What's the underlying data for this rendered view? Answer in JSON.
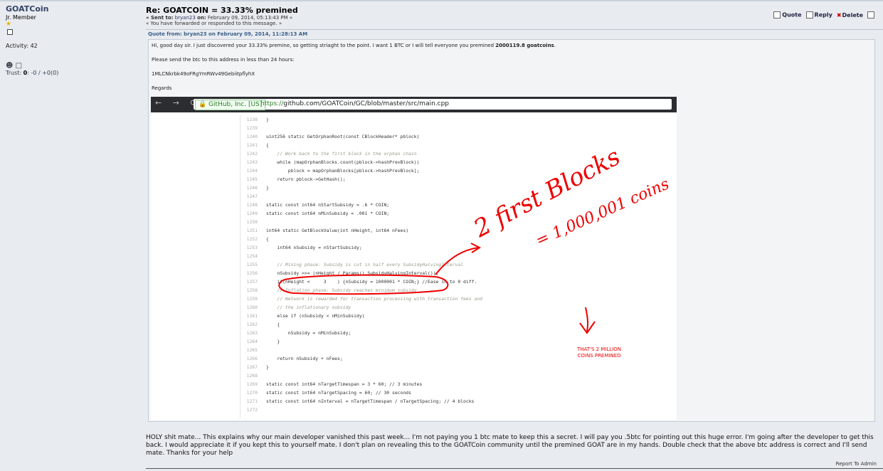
{
  "poster": {
    "name": "GOATCoin",
    "rank": "Jr. Member",
    "rank_star": "★",
    "activity": "Activity: 42",
    "trust_label": "Trust:",
    "trust_value": "0",
    "trust_rest": ": -0 / +0(0)"
  },
  "post": {
    "title": "Re: GOATCOIN = 33.33% premined",
    "sent_to_label": "« Sent to:",
    "sent_to_user": "bryan23",
    "sent_on_label": "on:",
    "sent_on_date": "February 09, 2014, 05:13:43 PM »",
    "forwarded_note": "« You have forwarded or responded to this message. »",
    "actions": {
      "quote": "Quote",
      "reply": "Reply",
      "delete": "Delete"
    }
  },
  "quote": {
    "header": "Quote from: bryan23 on February 09, 2014, 11:28:13 AM",
    "line1_pre": "Hi, good day sir. I just discovered your 33.33% premine, so getting striaght to the point. I want 1 BTC or I will tell everyone you premined ",
    "line1_bold": "2000119.8 goatcoins",
    "line1_post": ".",
    "line2": "Please send the btc to this address in less than 24 hours:",
    "line3": "1MLCNkrbk49oFRgYmRWv49GebiitpflyhX",
    "line4": "Regards"
  },
  "browser": {
    "nav_icons": "← → ⟳",
    "site_badge": "🔒 GitHub, Inc. [US]",
    "url_scheme": "https://",
    "url_rest": "github.com/GOATCoin/GC/blob/master/src/main.cpp"
  },
  "code_lines": [
    {
      "n": "1238",
      "t": "}"
    },
    {
      "n": "1239",
      "t": ""
    },
    {
      "n": "1240",
      "t": "uint256 static GetOrphanRoot(const CBlockHeader* pblock)"
    },
    {
      "n": "1241",
      "t": "{"
    },
    {
      "n": "1242",
      "t": "    // Work back to the first block in the orphan chain"
    },
    {
      "n": "1243",
      "t": "    while (mapOrphanBlocks.count(pblock->hashPrevBlock))"
    },
    {
      "n": "1244",
      "t": "        pblock = mapOrphanBlocks[pblock->hashPrevBlock];"
    },
    {
      "n": "1245",
      "t": "    return pblock->GetHash();"
    },
    {
      "n": "1246",
      "t": "}"
    },
    {
      "n": "1247",
      "t": ""
    },
    {
      "n": "1248",
      "t": "static const int64 nStartSubsidy = .6 * COIN;"
    },
    {
      "n": "1249",
      "t": "static const int64 nMinSubsidy = .001 * COIN;"
    },
    {
      "n": "1250",
      "t": ""
    },
    {
      "n": "1251",
      "t": "int64 static GetBlockValue(int nHeight, int64 nFees)"
    },
    {
      "n": "1252",
      "t": "{"
    },
    {
      "n": "1253",
      "t": "    int64 nSubsidy = nStartSubsidy;"
    },
    {
      "n": "1254",
      "t": ""
    },
    {
      "n": "1255",
      "t": "    // Mining phase: Subsidy is cut in half every SubsidyHalvingInterval"
    },
    {
      "n": "1256",
      "t": "    nSubsidy >>= (nHeight / Params().SubsidyHalvingInterval());"
    },
    {
      "n": "1257",
      "t": "    if(nHeight <     3    ) {nSubsidy = 1000001 * COIN;} //Ease in to 0 diff."
    },
    {
      "n": "1258",
      "t": "    // Inflation phase: Subsidy reaches minimum subsidy"
    },
    {
      "n": "1259",
      "t": "    // Network is rewarded for transaction processing with transaction fees and"
    },
    {
      "n": "1260",
      "t": "    // the inflationary subsidy"
    },
    {
      "n": "1261",
      "t": "    else if (nSubsidy < nMinSubsidy)"
    },
    {
      "n": "1262",
      "t": "    {"
    },
    {
      "n": "1263",
      "t": "        nSubsidy = nMinSubsidy;"
    },
    {
      "n": "1264",
      "t": "    }"
    },
    {
      "n": "1265",
      "t": ""
    },
    {
      "n": "1266",
      "t": "    return nSubsidy + nFees;"
    },
    {
      "n": "1267",
      "t": "}"
    },
    {
      "n": "1268",
      "t": ""
    },
    {
      "n": "1269",
      "t": "static const int64 nTargetTimespan = 3 * 60; // 3 minutes"
    },
    {
      "n": "1270",
      "t": "static const int64 nTargetSpacing = 60; // 30 seconds"
    },
    {
      "n": "1271",
      "t": "static const int64 nInterval = nTargetTimespan / nTargetSpacing; // 4 blocks"
    },
    {
      "n": "1272",
      "t": ""
    }
  ],
  "annotation": {
    "handwritten_1": "2 first Blocks",
    "handwritten_2": "= 1,000,001 coins",
    "red_note_1": "THAT'S 2 MILLION",
    "red_note_2": "COINS PREMINED",
    "color": "#e00000"
  },
  "message": "HOLY shit mate... This explains why our main developer vanished this past week... I'm not paying you 1 btc mate to keep this a secret. I will pay you .5btc for pointing out this huge error. I'm going after the developer to get this back. I would appreciate it if you kept this to yourself mate. I don't plan on revealing this to the GOATCoin community until the premined GOAT are in my hands. Double check that the above btc address is correct and I'll send mate. Thanks for your help",
  "report": "Report To Admin"
}
